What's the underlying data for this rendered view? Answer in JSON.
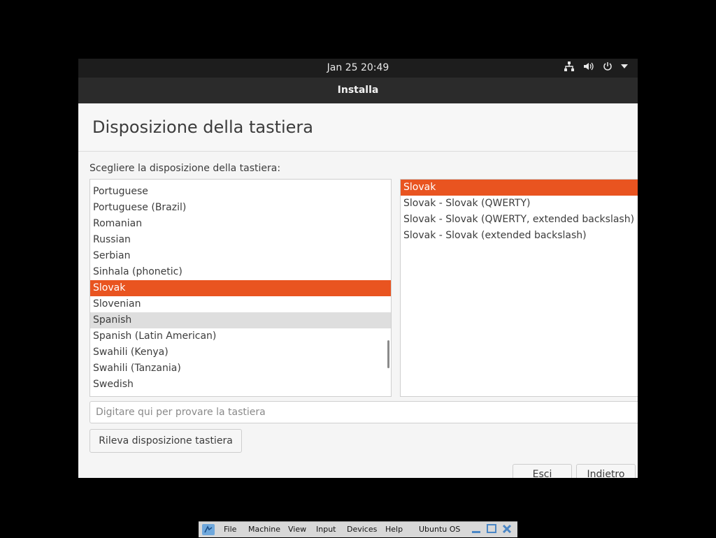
{
  "topbar": {
    "clock": "Jan 25  20:49",
    "tray_icons": [
      "network-icon",
      "volume-icon",
      "power-icon",
      "dropdown-arrow-icon"
    ]
  },
  "window": {
    "title": "Installa"
  },
  "page": {
    "title": "Disposizione della tastiera",
    "prompt": "Scegliere la disposizione della tastiera:"
  },
  "layouts": [
    {
      "label": "Portuguese",
      "state": ""
    },
    {
      "label": "Portuguese (Brazil)",
      "state": ""
    },
    {
      "label": "Romanian",
      "state": ""
    },
    {
      "label": "Russian",
      "state": ""
    },
    {
      "label": "Serbian",
      "state": ""
    },
    {
      "label": "Sinhala (phonetic)",
      "state": ""
    },
    {
      "label": "Slovak",
      "state": "selected"
    },
    {
      "label": "Slovenian",
      "state": ""
    },
    {
      "label": "Spanish",
      "state": "hover"
    },
    {
      "label": "Spanish (Latin American)",
      "state": ""
    },
    {
      "label": "Swahili (Kenya)",
      "state": ""
    },
    {
      "label": "Swahili (Tanzania)",
      "state": ""
    },
    {
      "label": "Swedish",
      "state": ""
    }
  ],
  "variants": [
    {
      "label": "Slovak",
      "state": "selected"
    },
    {
      "label": "Slovak - Slovak (QWERTY)",
      "state": ""
    },
    {
      "label": "Slovak - Slovak (QWERTY, extended backslash)",
      "state": ""
    },
    {
      "label": "Slovak - Slovak (extended backslash)",
      "state": ""
    }
  ],
  "test_input": {
    "placeholder": "Digitare qui per provare la tastiera",
    "value": ""
  },
  "buttons": {
    "detect": "Rileva disposizione tastiera",
    "quit": "Esci",
    "back": "Indietro"
  },
  "vbox": {
    "menus": [
      "File",
      "Machine",
      "View",
      "Input",
      "Devices",
      "Help"
    ],
    "machine_name": "Ubuntu OS"
  },
  "colors": {
    "accent": "#e95420",
    "hover": "#dedede"
  }
}
